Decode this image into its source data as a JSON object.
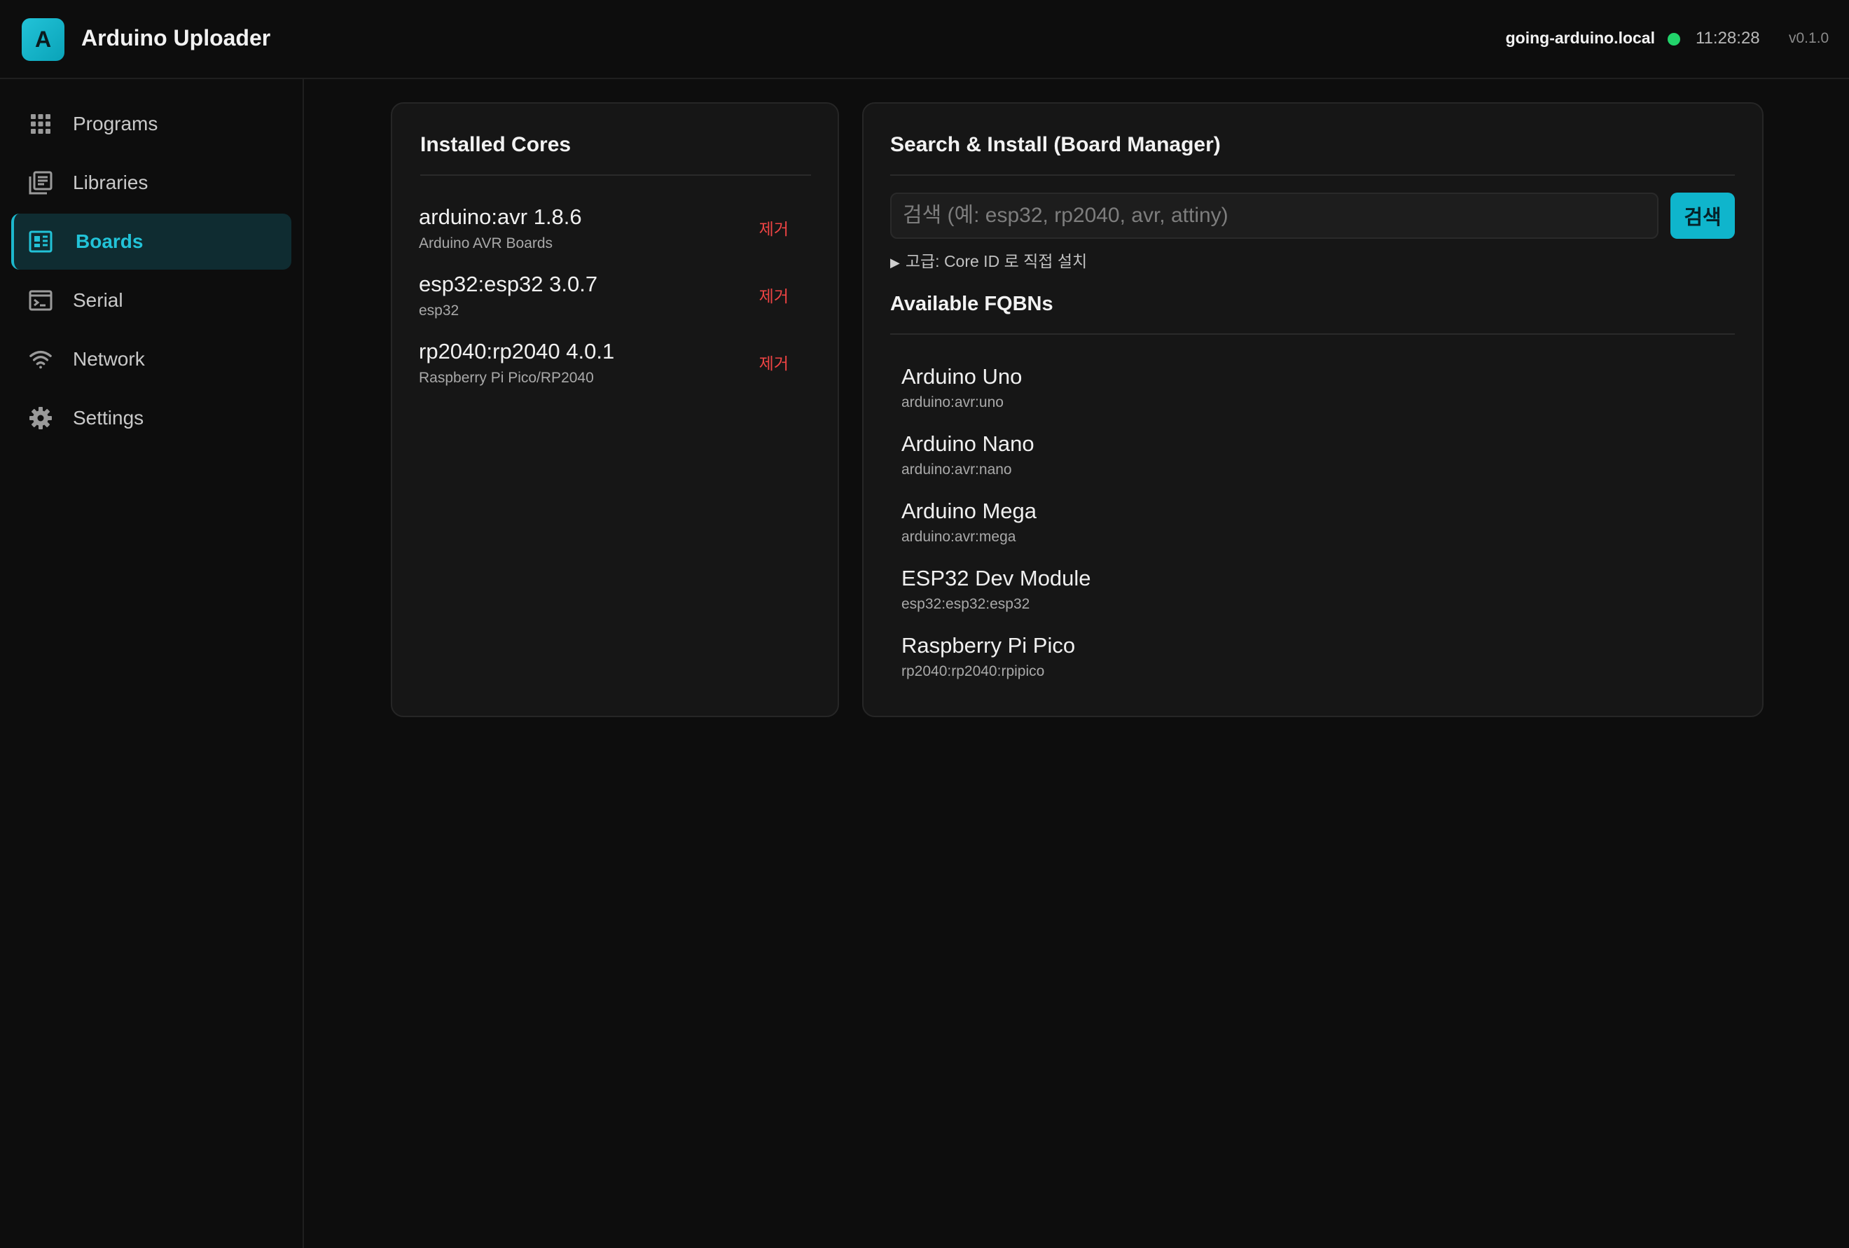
{
  "header": {
    "logo_letter": "A",
    "title": "Arduino Uploader",
    "host": "going-arduino.local",
    "status_color": "#22d36b",
    "time": "11:28:28",
    "version": "v0.1.0"
  },
  "sidebar": {
    "items": [
      {
        "label": "Programs",
        "icon": "grid-icon"
      },
      {
        "label": "Libraries",
        "icon": "library-icon"
      },
      {
        "label": "Boards",
        "icon": "board-icon",
        "active": true
      },
      {
        "label": "Serial",
        "icon": "terminal-icon"
      },
      {
        "label": "Network",
        "icon": "wifi-icon"
      },
      {
        "label": "Settings",
        "icon": "gear-icon"
      }
    ]
  },
  "installed": {
    "title": "Installed Cores",
    "cores": [
      {
        "name": "arduino:avr 1.8.6",
        "desc": "Arduino AVR Boards",
        "remove_label": "제거"
      },
      {
        "name": "esp32:esp32 3.0.7",
        "desc": "esp32",
        "remove_label": "제거"
      },
      {
        "name": "rp2040:rp2040 4.0.1",
        "desc": "Raspberry Pi Pico/RP2040",
        "remove_label": "제거"
      }
    ]
  },
  "manager": {
    "title": "Search & Install (Board Manager)",
    "search_placeholder": "검색 (예: esp32, rp2040, avr, attiny)",
    "search_value": "",
    "search_button": "검색",
    "advanced_label": "고급: Core ID 로 직접 설치",
    "fqbn_title": "Available FQBNs",
    "boards": [
      {
        "name": "Arduino Uno",
        "fqbn": "arduino:avr:uno"
      },
      {
        "name": "Arduino Nano",
        "fqbn": "arduino:avr:nano"
      },
      {
        "name": "Arduino Mega",
        "fqbn": "arduino:avr:mega"
      },
      {
        "name": "ESP32 Dev Module",
        "fqbn": "esp32:esp32:esp32"
      },
      {
        "name": "Raspberry Pi Pico",
        "fqbn": "rp2040:rp2040:rpipico"
      }
    ]
  },
  "colors": {
    "accent": "#22c3d8",
    "danger": "#ef4444",
    "background": "#0d0d0d",
    "card": "#161616"
  }
}
